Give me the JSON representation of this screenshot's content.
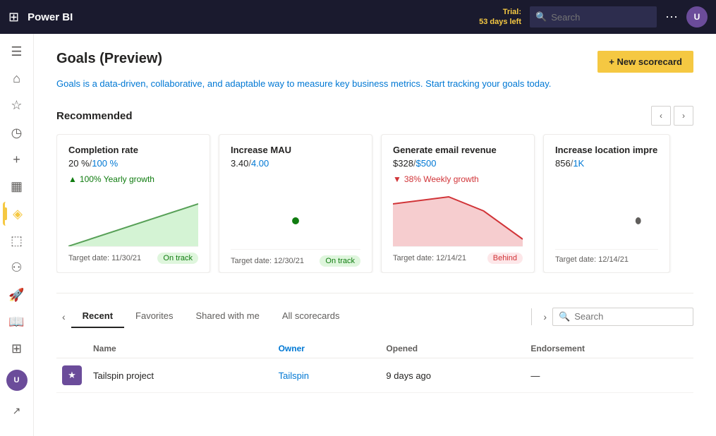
{
  "topnav": {
    "logo": "Power BI",
    "trial_label": "Trial:",
    "trial_days": "53 days left",
    "search_placeholder": "Search",
    "more_icon": "⋯",
    "avatar_initials": "U"
  },
  "sidebar": {
    "items": [
      {
        "id": "menu",
        "icon": "☰",
        "label": "Menu",
        "active": false
      },
      {
        "id": "home",
        "icon": "⌂",
        "label": "Home",
        "active": false
      },
      {
        "id": "favorites",
        "icon": "☆",
        "label": "Favorites",
        "active": false
      },
      {
        "id": "recent",
        "icon": "◷",
        "label": "Recent",
        "active": false
      },
      {
        "id": "create",
        "icon": "+",
        "label": "Create",
        "active": false
      },
      {
        "id": "datasets",
        "icon": "▦",
        "label": "Datasets",
        "active": false
      },
      {
        "id": "goals",
        "icon": "◈",
        "label": "Goals",
        "active": true
      },
      {
        "id": "metrics",
        "icon": "⬚",
        "label": "Metrics",
        "active": false
      },
      {
        "id": "people",
        "icon": "⚇",
        "label": "People",
        "active": false
      },
      {
        "id": "deploy",
        "icon": "⬆",
        "label": "Deploy",
        "active": false
      },
      {
        "id": "learn",
        "icon": "⊟",
        "label": "Learn",
        "active": false
      },
      {
        "id": "workspaces",
        "icon": "⊞",
        "label": "Workspaces",
        "active": false
      }
    ],
    "avatar_initials": "U",
    "external_icon": "↗"
  },
  "page": {
    "title": "Goals (Preview)",
    "subtitle": "Goals is a data-driven, collaborative, and adaptable way to measure key business metrics. Start tracking your goals today.",
    "new_scorecard_label": "+ New scorecard"
  },
  "recommended": {
    "title": "Recommended",
    "cards": [
      {
        "title": "Completion rate",
        "current": "20 %",
        "target": "100 %",
        "trend_icon": "▲",
        "trend_text": "100% Yearly growth",
        "trend_direction": "up",
        "target_date": "Target date: 11/30/21",
        "status": "On track",
        "status_type": "on-track",
        "chart_type": "triangle-up"
      },
      {
        "title": "Increase MAU",
        "current": "3.40",
        "target": "4.00",
        "trend_icon": "",
        "trend_text": "",
        "trend_direction": "none",
        "target_date": "Target date: 12/30/21",
        "status": "On track",
        "status_type": "on-track",
        "chart_type": "dot"
      },
      {
        "title": "Generate email revenue",
        "current": "$328",
        "target": "$500",
        "trend_icon": "▼",
        "trend_text": "38% Weekly growth",
        "trend_direction": "down",
        "target_date": "Target date: 12/14/21",
        "status": "Behind",
        "status_type": "behind",
        "chart_type": "mountain-down"
      },
      {
        "title": "Increase location impre",
        "current": "856",
        "target": "1K",
        "trend_icon": "",
        "trend_text": "",
        "trend_direction": "none",
        "target_date": "Target date: 12/14/21",
        "status": "",
        "status_type": "none",
        "chart_type": "dot-right"
      }
    ]
  },
  "tabs": {
    "items": [
      {
        "label": "Recent",
        "active": true
      },
      {
        "label": "Favorites",
        "active": false
      },
      {
        "label": "Shared with me",
        "active": false
      },
      {
        "label": "All scorecards",
        "active": false
      }
    ],
    "search_placeholder": "Search"
  },
  "table": {
    "columns": [
      "",
      "Name",
      "Owner",
      "Opened",
      "Endorsement"
    ],
    "rows": [
      {
        "icon": "★",
        "name": "Tailspin project",
        "owner": "Tailspin",
        "opened": "9 days ago",
        "endorsement": "—"
      }
    ]
  }
}
